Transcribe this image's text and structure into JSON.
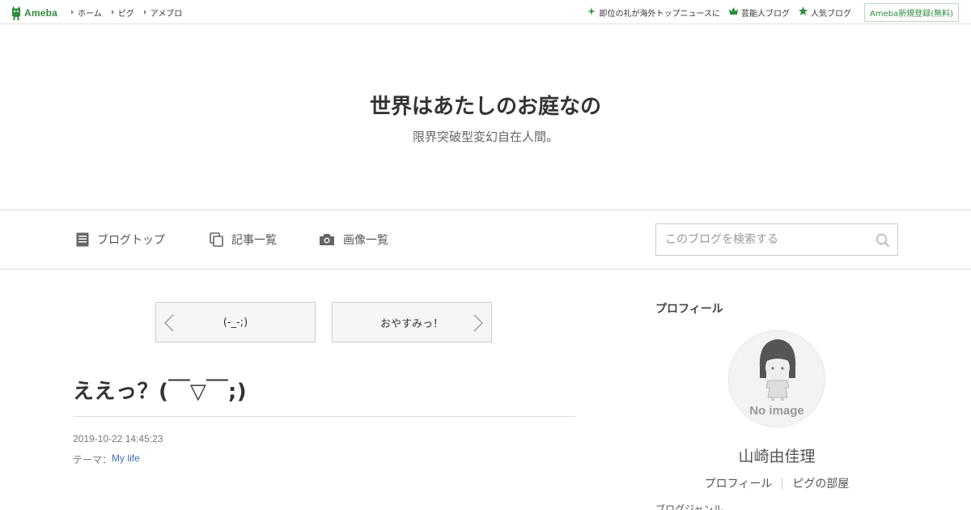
{
  "header": {
    "logo_text": "Ameba",
    "nav": [
      "ホーム",
      "ピグ",
      "アメブロ"
    ],
    "right_links": [
      {
        "label": "即位の礼が海外トップニュースに",
        "icon": "sparkle-icon"
      },
      {
        "label": "芸能人ブログ",
        "icon": "crown-icon"
      },
      {
        "label": "人気ブログ",
        "icon": "star-icon"
      }
    ],
    "register_label": "Ameba新規登録(無料)"
  },
  "blog": {
    "title": "世界はあたしのお庭なの",
    "description": "限界突破型変幻自在人間。"
  },
  "blog_nav": {
    "items": [
      {
        "label": "ブログトップ",
        "icon": "document-icon"
      },
      {
        "label": "記事一覧",
        "icon": "copy-icon"
      },
      {
        "label": "画像一覧",
        "icon": "camera-icon"
      }
    ],
    "search_placeholder": "このブログを検索する"
  },
  "pager": {
    "prev_label": "(-_-;)",
    "next_label": "おやすみっ！"
  },
  "entry": {
    "title": "ええっ？(￣▽￣;)",
    "date": "2019-10-22 14:45:23",
    "theme_prefix": "テーマ：",
    "theme": "My life"
  },
  "sidebar": {
    "heading": "プロフィール",
    "avatar_text": "No image",
    "name": "山崎由佳理",
    "links": [
      "プロフィール",
      "ピグの部屋"
    ],
    "next_heading": "ブログジャンル"
  },
  "colors": {
    "brand_green": "#2d8c3c",
    "link_blue": "#3b72b8"
  }
}
